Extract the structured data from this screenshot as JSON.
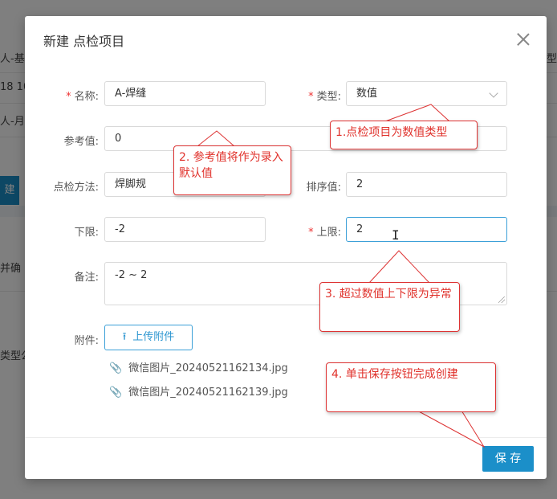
{
  "background": {
    "rows": [
      "人-基",
      "18 10",
      "人-月",
      "并确",
      "类型公"
    ],
    "edge_right": "型",
    "button_label": "建"
  },
  "modal": {
    "title": "新建 点检项目",
    "close_icon": "close-icon"
  },
  "form": {
    "name": {
      "label": "名称:",
      "required_mark": "*",
      "value": "A-焊缝"
    },
    "type": {
      "label": "类型:",
      "required_mark": "*",
      "value": "数值"
    },
    "ref": {
      "label": "参考值:",
      "value": "0"
    },
    "method": {
      "label": "点检方法:",
      "value": "焊脚规"
    },
    "order": {
      "label": "排序值:",
      "value": "2"
    },
    "lower": {
      "label": "下限:",
      "value": "-2"
    },
    "upper": {
      "label": "上限:",
      "required_mark": "*",
      "value": "2"
    },
    "remark": {
      "label": "备注:",
      "value": "-2 ~ 2"
    },
    "attachment": {
      "label": "附件:",
      "upload_label": "上传附件",
      "files": [
        "微信图片_20240521162134.jpg",
        "微信图片_20240521162139.jpg"
      ]
    }
  },
  "footer": {
    "save_label": "保 存"
  },
  "callouts": {
    "c1": "1.点检项目为数值类型",
    "c2": "2. 参考值将作为录入默认值",
    "c3": "3. 超过数值上下限为异常",
    "c4": "4. 单击保存按钮完成创建"
  },
  "colors": {
    "accent": "#1b8fc9",
    "required": "#e33333",
    "callout_text": "#e0312b"
  }
}
